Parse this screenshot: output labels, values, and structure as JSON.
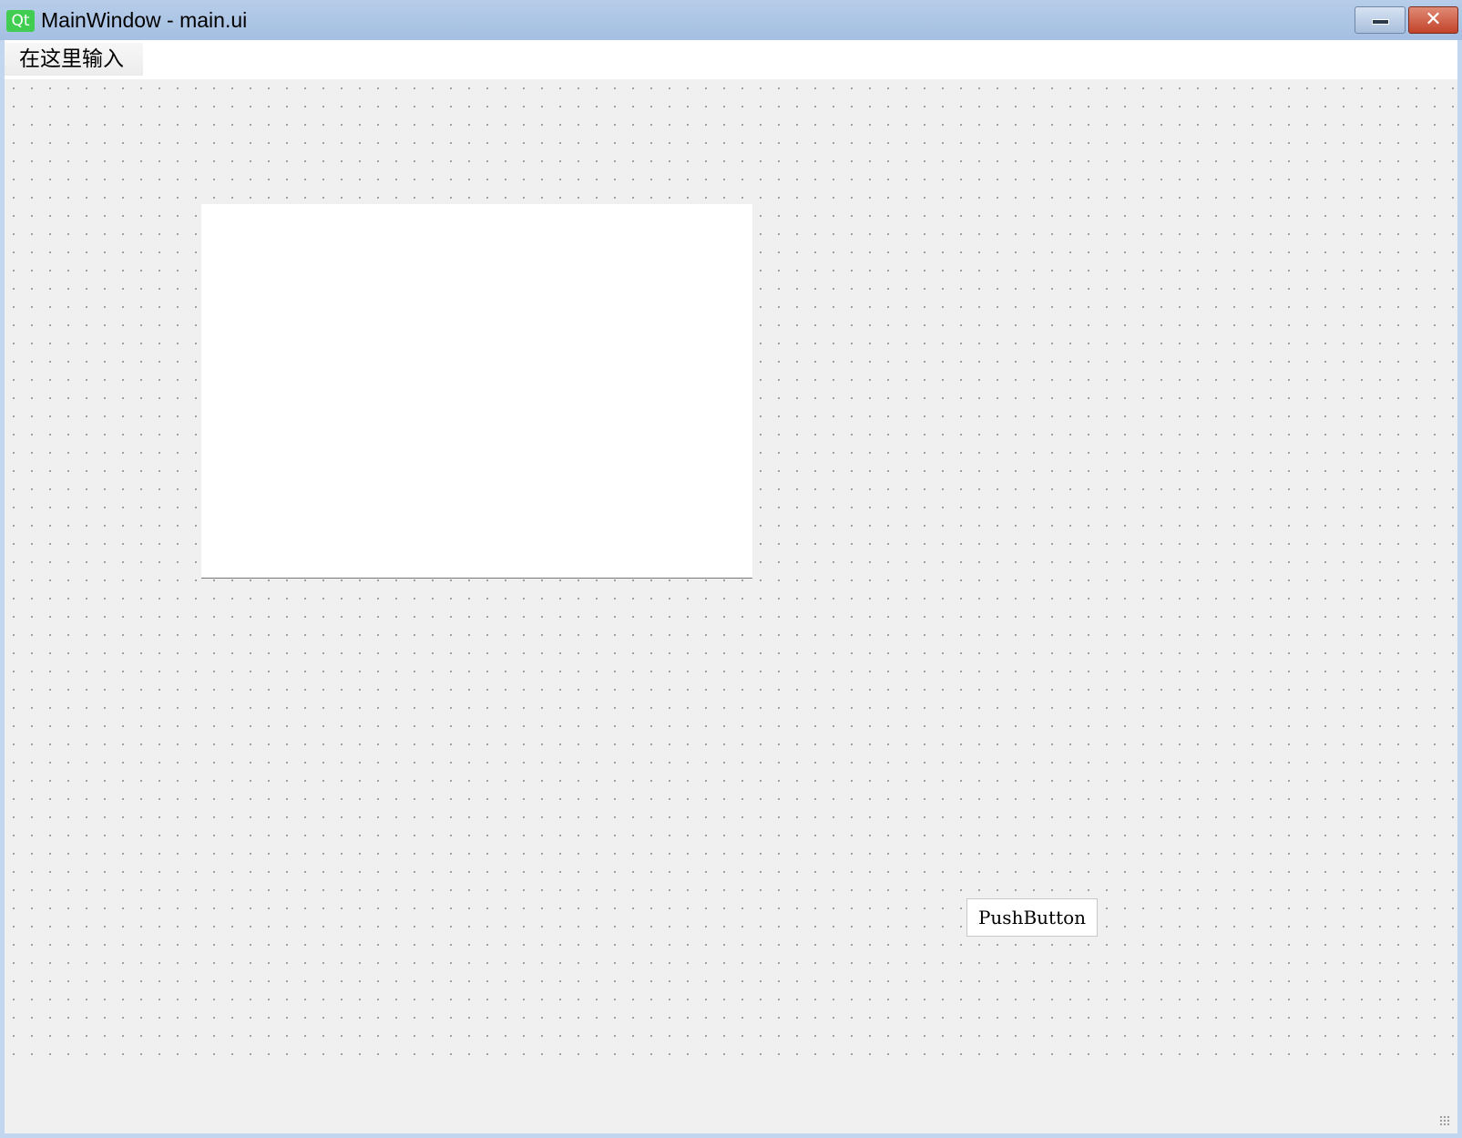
{
  "window": {
    "logo_text": "Qt",
    "title": "MainWindow - main.ui"
  },
  "menubar": {
    "placeholder_item": "在这里输入"
  },
  "form": {
    "push_button_label": "PushButton"
  },
  "colors": {
    "titlebar": "#a4bfe2",
    "canvas": "#f0f0f0",
    "close_button": "#c2432a",
    "qt_logo": "#41cd52"
  },
  "icons": [
    "qt-logo-icon",
    "minimize-icon",
    "close-icon",
    "resize-grip-icon"
  ]
}
